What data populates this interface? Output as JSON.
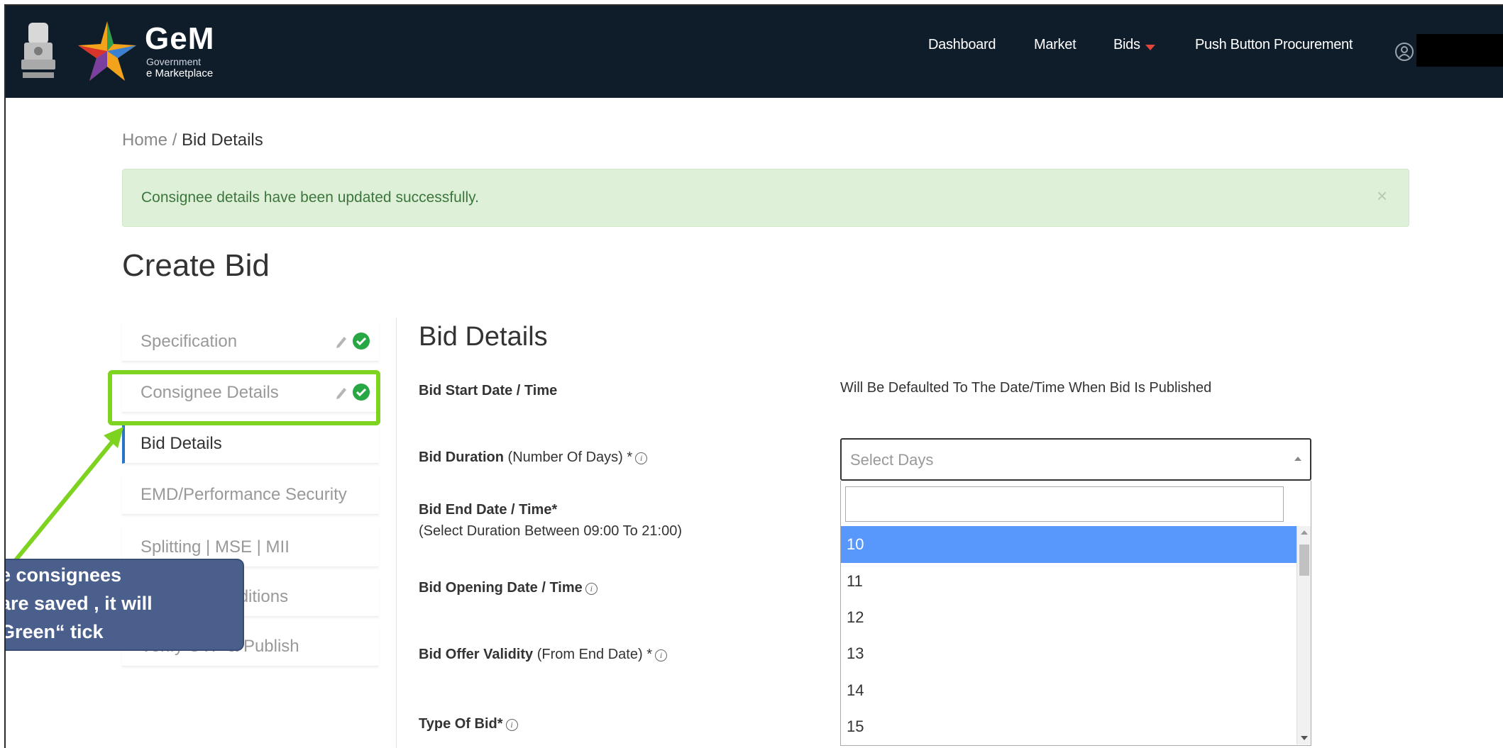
{
  "header": {
    "brand_title": "GeM",
    "brand_sub1": "Government",
    "brand_sub2": "e Marketplace",
    "nav": [
      "Dashboard",
      "Market",
      "Bids",
      "Push Button Procurement"
    ],
    "icons": {
      "emblem": "national-emblem-icon",
      "logo": "gem-star-logo",
      "bids_caret": "caret-down-icon",
      "user": "user-icon"
    }
  },
  "breadcrumb": {
    "home": "Home",
    "separator": " / ",
    "current": "Bid Details"
  },
  "alert": {
    "message": "Consignee details have been updated successfully.",
    "close": "×"
  },
  "page_title": "Create Bid",
  "steps": [
    {
      "label": "Specification",
      "status": "done"
    },
    {
      "label": "Consignee Details",
      "status": "done"
    },
    {
      "label": "Bid Details",
      "status": "active"
    },
    {
      "label": "EMD/Performance Security",
      "status": "pending"
    },
    {
      "label": "Splitting | MSE | MII",
      "status": "pending"
    },
    {
      "label": "Terms & Conditions",
      "status": "pending"
    },
    {
      "label": "Verify OTP & Publish",
      "status": "pending"
    }
  ],
  "form": {
    "section_title": "Bid Details",
    "start_label": "Bid Start Date / Time",
    "start_value": "Will Be Defaulted To The Date/Time When Bid Is Published",
    "duration_label_bold": "Bid Duration",
    "duration_label_rest": " (Number Of Days) *",
    "end_label": "Bid End Date / Time*",
    "end_note": "(Select Duration Between 09:00 To 21:00)",
    "opening_label": "Bid Opening Date / Time",
    "validity_label_bold": "Bid Offer Validity",
    "validity_label_rest": " (From End Date) *",
    "type_label": "Type Of Bid*"
  },
  "duration_select": {
    "placeholder": "Select Days",
    "search_value": "",
    "options": [
      "10",
      "11",
      "12",
      "13",
      "14",
      "15"
    ],
    "highlighted": "10"
  },
  "annotation": {
    "lines": [
      "e consignees",
      "are saved  , it will",
      "Green“ tick"
    ],
    "color": "#7ed321",
    "callout_bg": "#4a5f8c"
  }
}
